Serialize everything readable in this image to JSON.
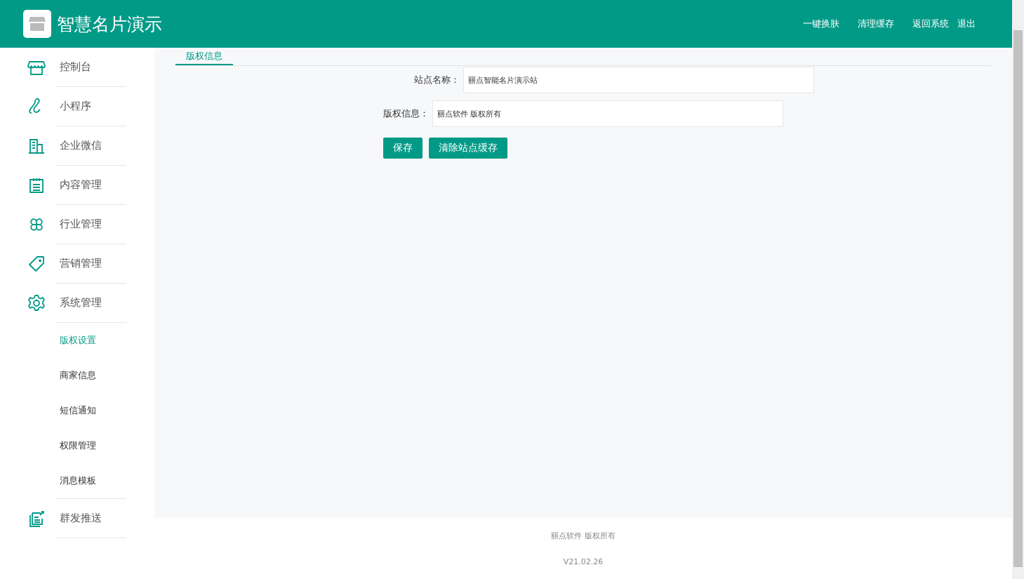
{
  "header": {
    "title": "智慧名片演示",
    "links": [
      "一键换肤",
      "清理缓存",
      "返回系统",
      "退出"
    ]
  },
  "sidebar": {
    "items": [
      {
        "label": "控制台",
        "selected": false
      },
      {
        "label": "小程序",
        "selected": false
      },
      {
        "label": "企业微信",
        "selected": false
      },
      {
        "label": "内容管理",
        "selected": false
      },
      {
        "label": "行业管理",
        "selected": false
      },
      {
        "label": "营销管理",
        "selected": false
      },
      {
        "label": "系统管理",
        "selected": false,
        "children": [
          {
            "label": "版权设置",
            "selected": true
          },
          {
            "label": "商家信息",
            "selected": false
          },
          {
            "label": "短信通知",
            "selected": false
          },
          {
            "label": "权限管理",
            "selected": false
          },
          {
            "label": "消息模板",
            "selected": false
          }
        ]
      },
      {
        "label": "群发推送",
        "selected": false
      }
    ]
  },
  "tabs": [
    {
      "label": "版权信息",
      "selected": true
    }
  ],
  "form": {
    "fields": [
      {
        "label": "站点名称：",
        "value": "丽点智能名片演示站"
      },
      {
        "label": "版权信息：",
        "value": "丽点软件 版权所有"
      }
    ],
    "buttons": [
      "保存",
      "清除站点缓存"
    ]
  },
  "footer": {
    "copyright": "丽点软件 版权所有",
    "version": "V21.02.26"
  }
}
